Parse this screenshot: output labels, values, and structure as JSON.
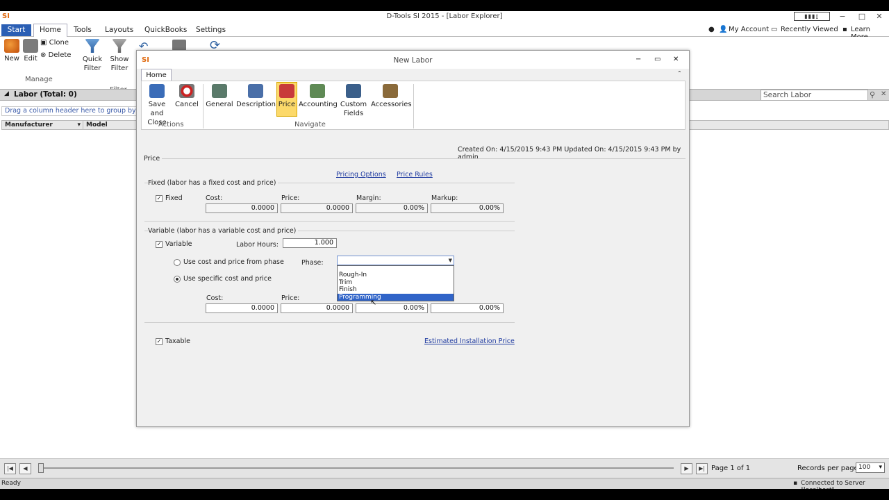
{
  "app": {
    "logo": "SI",
    "title": "D-Tools SI 2015 - [Labor Explorer]"
  },
  "menu": {
    "items": [
      "Start",
      "Home",
      "Tools",
      "Layouts",
      "QuickBooks",
      "Settings"
    ],
    "right": [
      "My Account",
      "Recently Viewed",
      "Learn More"
    ]
  },
  "ribbon": {
    "new": "New",
    "edit": "Edit",
    "clone": "Clone",
    "delete": "Delete",
    "quick_filter": "Quick Filter",
    "show_filter": "Show Filter",
    "manage": "Manage",
    "filter": "Filter"
  },
  "labor_panel": {
    "title": "Labor (Total: 0)",
    "search_placeholder": "Search Labor",
    "group_hint": "Drag a column header here to group by that column",
    "columns": [
      "Manufacturer",
      "Model"
    ]
  },
  "pager": {
    "page_text": "Page 1 of 1",
    "records_label": "Records per page",
    "records_value": "100"
  },
  "status": {
    "left": "Ready",
    "right": "Connected to Server \"localhost\""
  },
  "dialog": {
    "logo": "SI",
    "title": "New Labor",
    "tab": "Home",
    "buttons": {
      "save_close": "Save and Close",
      "cancel": "Cancel",
      "general": "General",
      "description": "Description",
      "price": "Price",
      "accounting": "Accounting",
      "custom_fields": "Custom Fields",
      "accessories": "Accessories"
    },
    "groups": {
      "actions": "Actions",
      "navigate": "Navigate"
    },
    "created_info": "Created On: 4/15/2015 9:43 PM  Updated On: 4/15/2015 9:43 PM by admin",
    "section_title": "Price",
    "links": {
      "pricing_options": "Pricing Options",
      "price_rules": "Price Rules",
      "estimated_install": "Estimated Installation Price"
    },
    "fixed": {
      "legend": "Fixed (labor has a fixed cost and price)",
      "checkbox_label": "Fixed",
      "cost_label": "Cost:",
      "price_label": "Price:",
      "margin_label": "Margin:",
      "markup_label": "Markup:",
      "cost": "0.0000",
      "price": "0.0000",
      "margin": "0.00%",
      "markup": "0.00%"
    },
    "variable": {
      "legend": "Variable (labor has a variable cost and price)",
      "checkbox_label": "Variable",
      "hours_label": "Labor Hours:",
      "hours": "1.000",
      "radio_phase": "Use cost and price from phase",
      "radio_specific": "Use specific cost and price",
      "phase_label": "Phase:",
      "phase_options": [
        "Rough-In",
        "Trim",
        "Finish",
        "Programming"
      ],
      "cost_label": "Cost:",
      "price_label": "Price:",
      "cost": "0.0000",
      "price": "0.0000",
      "margin": "0.00%",
      "markup": "0.00%"
    },
    "taxable_label": "Taxable"
  }
}
